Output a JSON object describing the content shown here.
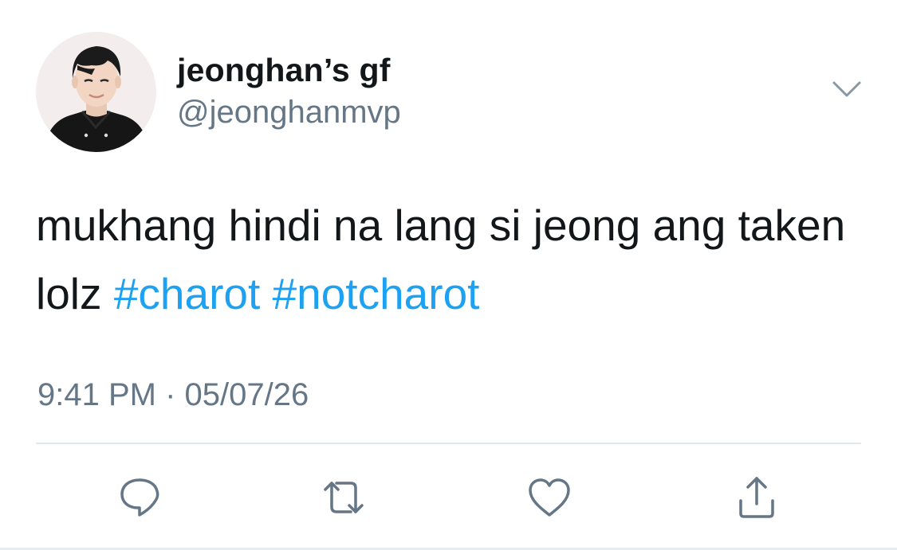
{
  "user": {
    "display_name": "jeonghan’s gf",
    "handle": "@jeonghanmvp"
  },
  "tweet": {
    "text_plain": "mukhang hindi na lang si jeong ang taken lolz",
    "hashtags": [
      "#charot",
      "#notcharot"
    ],
    "time": "9:41 PM",
    "separator": "·",
    "date": "05/07/26"
  },
  "icons": {
    "menu": "chevron-down-icon",
    "reply": "reply-icon",
    "retweet": "retweet-icon",
    "like": "heart-icon",
    "share": "share-icon"
  },
  "colors": {
    "text": "#14171a",
    "secondary": "#657786",
    "link": "#1da1f2",
    "divider": "#e1e8ed"
  }
}
